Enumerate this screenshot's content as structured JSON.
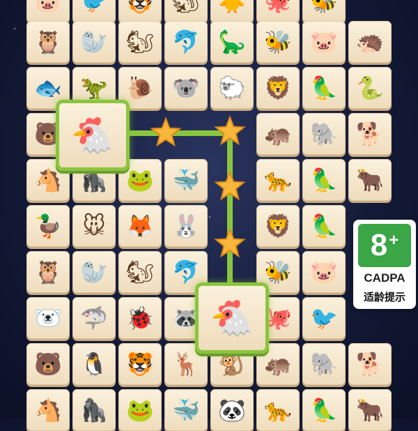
{
  "game": {
    "rows": [
      [
        "🐷",
        "🐦",
        "🐯",
        "🐿",
        "🐥",
        "🐙",
        "🐝"
      ],
      [
        "🦉",
        "🦭",
        "🐿",
        "🐬",
        "🦕",
        "🐝",
        "🐷",
        "🦔"
      ],
      [
        "🐟",
        "🦖",
        "🐌",
        "🐨",
        "🐑",
        "🦁",
        "🦜",
        "🐍"
      ],
      [
        "🐻",
        "🐔",
        "",
        "",
        "",
        "🦛",
        "🐘",
        "🐕"
      ],
      [
        "🐴",
        "🦍",
        "🐸",
        "🐳",
        "",
        "🐆",
        "🦜",
        "🐂"
      ],
      [
        "🦆",
        "🐭",
        "🦊",
        "🐰",
        "",
        "🦁",
        "🦜",
        ""
      ],
      [
        "🦉",
        "🦭",
        "🐿",
        "🐬",
        "",
        "🐝",
        "🐷",
        ""
      ],
      [
        "🐻‍❄️",
        "🦈",
        "🐞",
        "🦝",
        "🐔",
        "🐙",
        "🐦",
        ""
      ],
      [
        "🐻",
        "🐧",
        "🐯",
        "🦌",
        "🐒",
        "🦛",
        "🐘",
        "🐕"
      ],
      [
        "🐴",
        "🦍",
        "🐸",
        "🐳",
        "🐼",
        "🐆",
        "🦜",
        "🐂"
      ]
    ],
    "selected": [
      {
        "name": "chicken-tile-selected-top",
        "glyph": "🐔"
      },
      {
        "name": "chicken-tile-selected-bottom",
        "glyph": "🐔"
      }
    ],
    "path_star_icon": "star-icon",
    "path_color": "#8bc53f"
  },
  "badge": {
    "rating_number": "8",
    "rating_plus": "+",
    "org": "CADPA",
    "hint": "适龄提示",
    "color": "#3aa646"
  }
}
